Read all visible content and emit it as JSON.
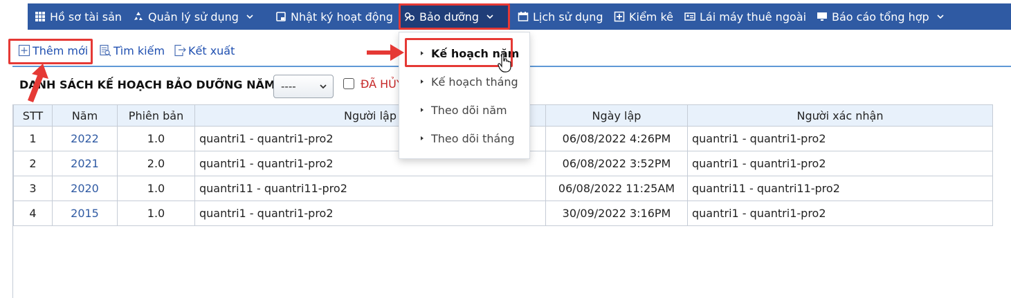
{
  "nav": {
    "items": [
      {
        "label": "Hồ sơ tài sản",
        "icon": "grid-icon"
      },
      {
        "label": "Quản lý sử dụng",
        "icon": "recycle-icon"
      },
      {
        "label": "Nhật ký hoạt động",
        "icon": "log-icon"
      },
      {
        "label": "Bảo dưỡng",
        "icon": "wrench-icon"
      },
      {
        "label": "Lịch sử dụng",
        "icon": "calendar-icon"
      },
      {
        "label": "Kiểm kê",
        "icon": "inventory-icon"
      },
      {
        "label": "Lái máy thuê ngoài",
        "icon": "id-card-icon"
      },
      {
        "label": "Báo cáo tổng hợp",
        "icon": "monitor-icon"
      }
    ]
  },
  "toolbar": {
    "add_label": "Thêm mới",
    "search_label": "Tìm kiếm",
    "export_label": "Kết xuất"
  },
  "dropdown": {
    "items": [
      {
        "label": "Kế hoạch năm",
        "selected": true
      },
      {
        "label": "Kế hoạch tháng"
      },
      {
        "label": "Theo dõi năm"
      },
      {
        "label": "Theo dõi tháng"
      }
    ]
  },
  "list": {
    "title": "DANH SÁCH KẾ HOẠCH BẢO DƯỠNG NĂM",
    "filter_value": "----",
    "cancel_label": "ĐÃ HỦY"
  },
  "table": {
    "headers": [
      "STT",
      "Năm",
      "Phiên bản",
      "Người lập",
      "Ngày lập",
      "Người xác nhận"
    ],
    "rows": [
      [
        "1",
        "2022",
        "1.0",
        "quantri1 - quantri1-pro2",
        "06/08/2022 4:26PM",
        "quantri1 - quantri1-pro2"
      ],
      [
        "2",
        "2021",
        "2.0",
        "quantri1 - quantri1-pro2",
        "06/08/2022 3:52PM",
        "quantri1 - quantri1-pro2"
      ],
      [
        "3",
        "2020",
        "1.0",
        "quantri11 - quantri11-pro2",
        "06/08/2022 11:25AM",
        "quantri11 - quantri11-pro2"
      ],
      [
        "4",
        "2015",
        "1.0",
        "quantri1 - quantri1-pro2",
        "30/09/2022 3:16PM",
        "quantri1 - quantri1-pro2"
      ]
    ]
  },
  "colors": {
    "nav_bg": "#2f5aa3",
    "accent_red": "#e53935",
    "link_blue": "#1f4fb0",
    "header_bg": "#e8f1fb"
  }
}
